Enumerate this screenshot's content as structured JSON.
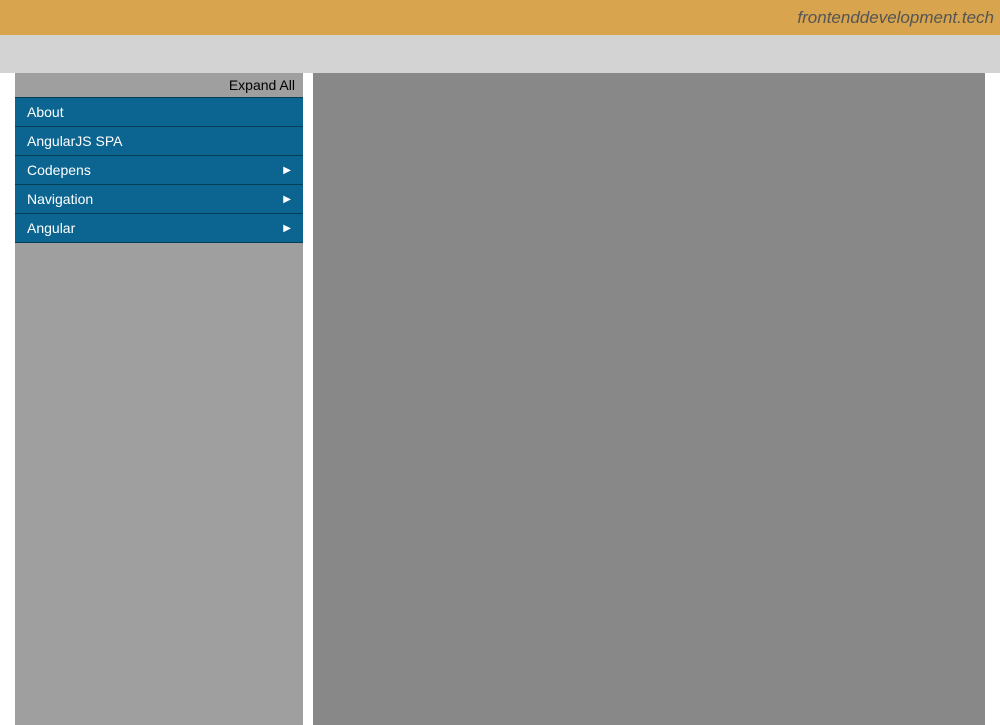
{
  "header": {
    "site_title": "frontenddevelopment.tech"
  },
  "sidebar": {
    "expand_all_label": "Expand All",
    "items": [
      {
        "label": "About",
        "has_children": false
      },
      {
        "label": "AngularJS SPA",
        "has_children": false
      },
      {
        "label": "Codepens",
        "has_children": true
      },
      {
        "label": "Navigation",
        "has_children": true
      },
      {
        "label": "Angular",
        "has_children": true
      }
    ]
  }
}
